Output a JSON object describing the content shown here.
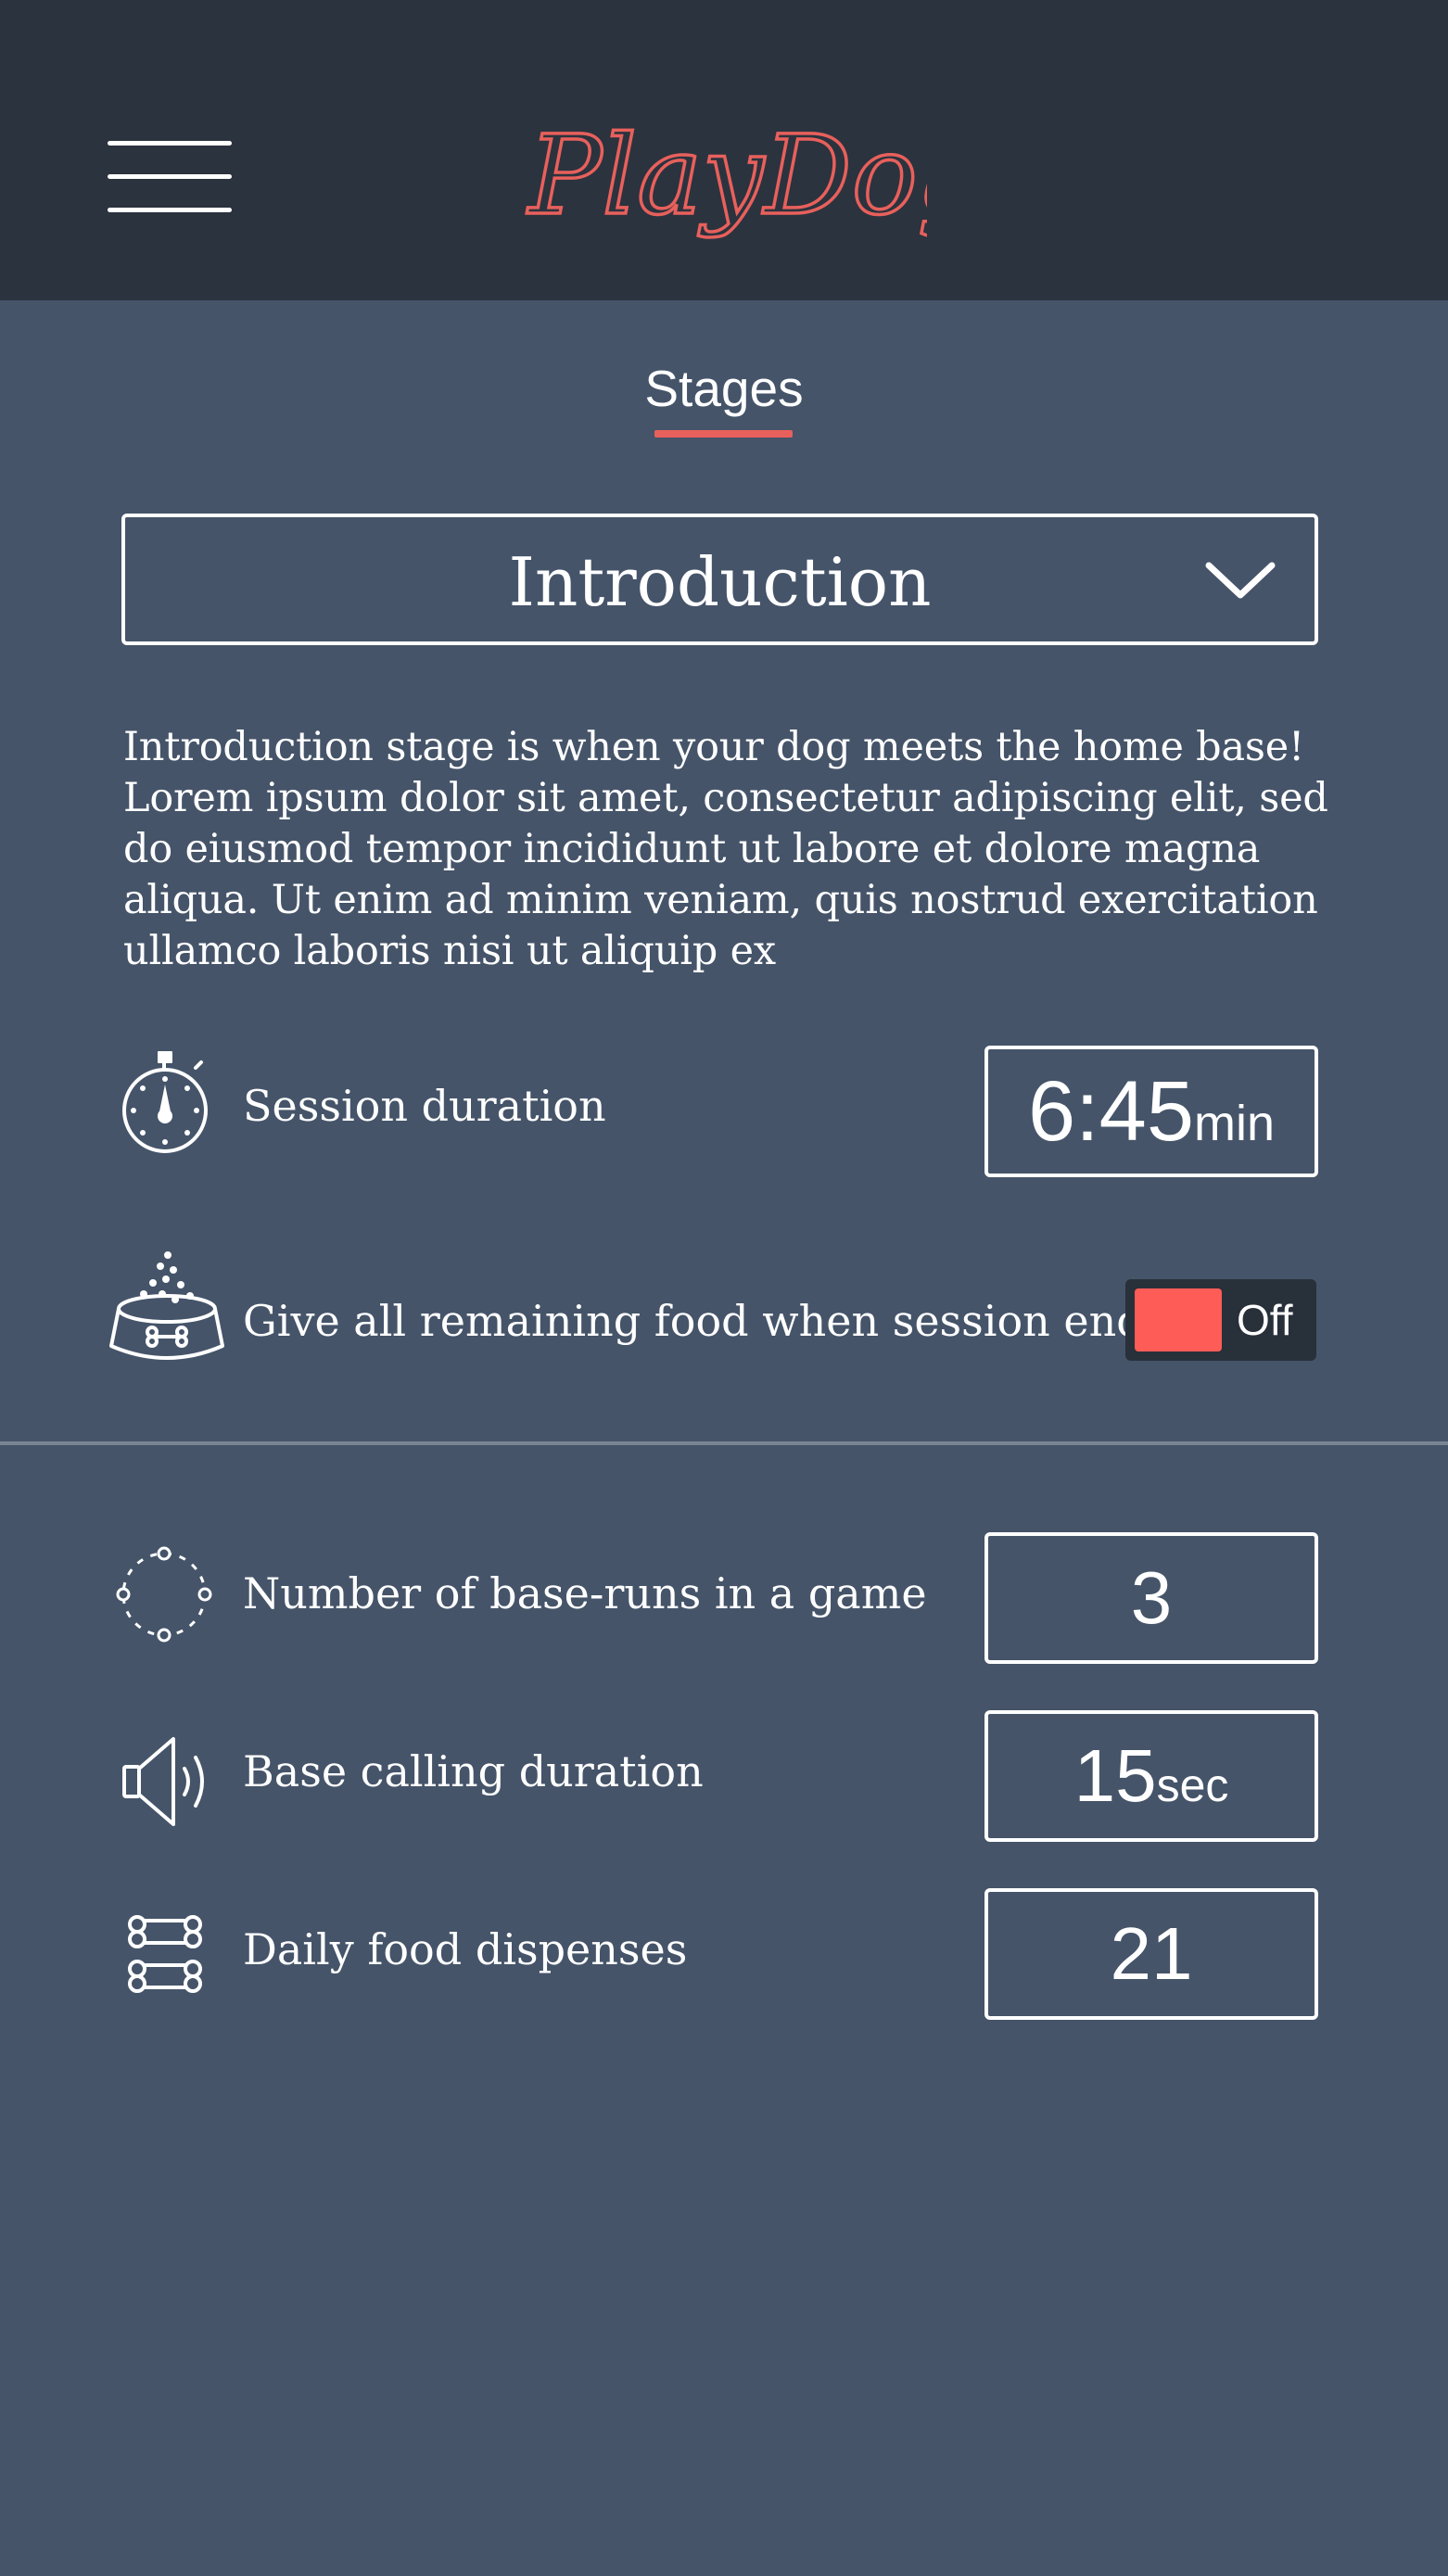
{
  "header": {
    "menu_icon": "hamburger-menu-icon",
    "logo_text": "PlayDog"
  },
  "tabs": {
    "active_label": "Stages",
    "accent_color": "#e8605c"
  },
  "stage_select": {
    "value": "Introduction",
    "icon": "chevron-down-icon"
  },
  "description": "Introduction stage is when your dog meets the home base! Lorem ipsum dolor sit amet, consectetur adipiscing elit, sed do eiusmod tempor incididunt ut labore et dolore magna aliqua. Ut enim ad minim veniam, quis nostrud exercitation ullamco laboris nisi ut aliquip ex",
  "session_duration": {
    "icon": "stopwatch-icon",
    "label": "Session duration",
    "value": "6:45",
    "unit": "min"
  },
  "remaining_food": {
    "icon": "dog-food-bowl-icon",
    "label": "Give all remaining food when session ends",
    "toggle_label": "Off",
    "toggle_color": "#fd5c57"
  },
  "base_runs": {
    "icon": "dotted-circle-icon",
    "label": "Number of base-runs in a game",
    "value": "3"
  },
  "base_calling": {
    "icon": "speaker-icon",
    "label": "Base calling duration",
    "value": "15",
    "unit": "sec"
  },
  "daily_food": {
    "icon": "bones-icon",
    "label": "Daily food dispenses",
    "value": "21"
  },
  "colors": {
    "header_bg": "#2b333e",
    "page_bg": "#455469",
    "accent": "#e8605c"
  }
}
